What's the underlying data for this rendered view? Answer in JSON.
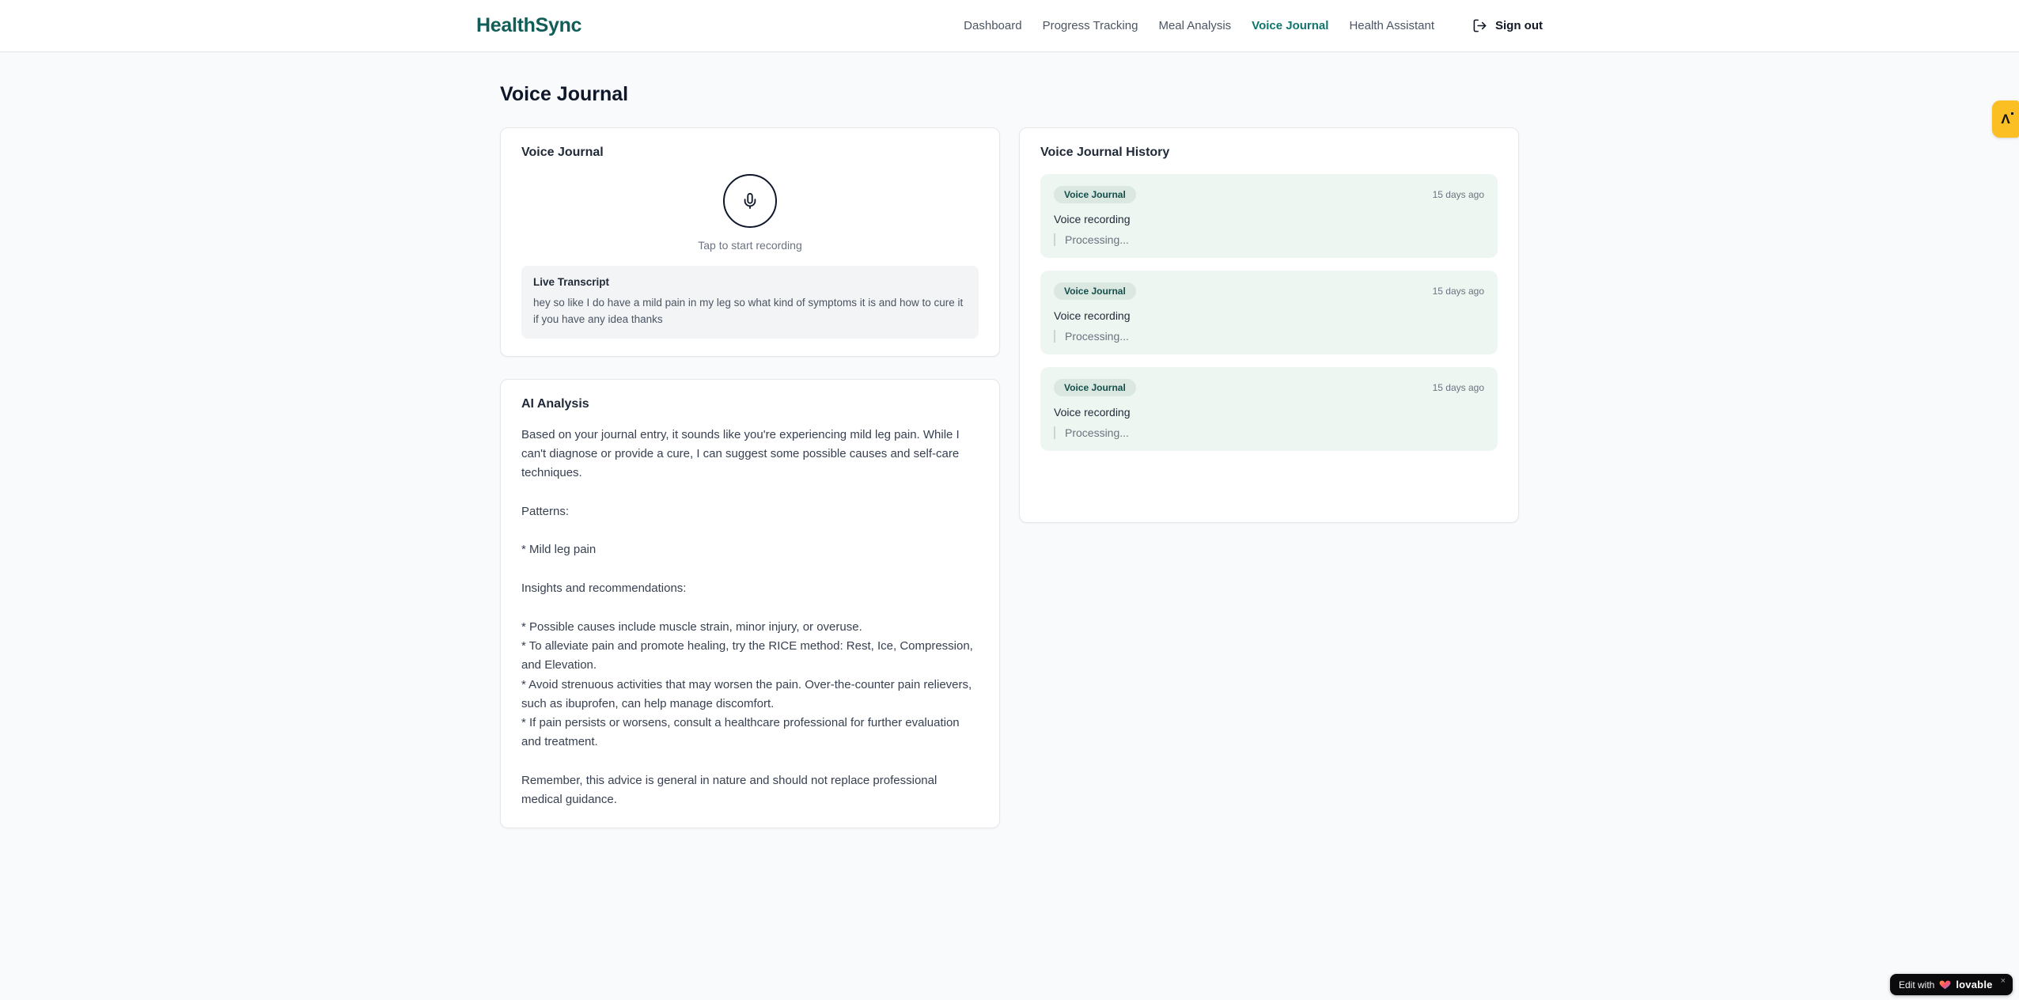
{
  "brand": {
    "name": "HealthSync"
  },
  "nav": {
    "items": [
      {
        "label": "Dashboard"
      },
      {
        "label": "Progress Tracking"
      },
      {
        "label": "Meal Analysis"
      },
      {
        "label": "Voice Journal"
      },
      {
        "label": "Health Assistant"
      }
    ],
    "active_item": "Voice Journal",
    "sign_out_label": "Sign out"
  },
  "page": {
    "title": "Voice Journal"
  },
  "recorder_card": {
    "title": "Voice Journal",
    "tap_hint": "Tap to start recording",
    "transcript_title": "Live Transcript",
    "transcript_text": "hey so like I do have a mild pain in my leg so what kind of symptoms it is and how to cure it if you have any idea thanks"
  },
  "analysis_card": {
    "title": "AI Analysis",
    "body": "Based on your journal entry, it sounds like you're experiencing mild leg pain. While I can't diagnose or provide a cure, I can suggest some possible causes and self-care techniques.\n\nPatterns:\n\n* Mild leg pain\n\nInsights and recommendations:\n\n* Possible causes include muscle strain, minor injury, or overuse.\n* To alleviate pain and promote healing, try the RICE method: Rest, Ice, Compression, and Elevation.\n* Avoid strenuous activities that may worsen the pain. Over-the-counter pain relievers, such as ibuprofen, can help manage discomfort.\n* If pain persists or worsens, consult a healthcare professional for further evaluation and treatment.\n\nRemember, this advice is general in nature and should not replace professional medical guidance."
  },
  "history_card": {
    "title": "Voice Journal History",
    "entries": [
      {
        "badge": "Voice Journal",
        "time": "15 days ago",
        "title": "Voice recording",
        "status": "Processing..."
      },
      {
        "badge": "Voice Journal",
        "time": "15 days ago",
        "title": "Voice recording",
        "status": "Processing..."
      },
      {
        "badge": "Voice Journal",
        "time": "15 days ago",
        "title": "Voice recording",
        "status": "Processing..."
      }
    ]
  },
  "floating": {
    "side_fab_glyph": "Λ",
    "edit_badge": {
      "prefix": "Edit with",
      "brand": "lovable",
      "close": "×"
    }
  },
  "colors": {
    "brand_teal": "#115e59",
    "active_nav_teal": "#0f766e",
    "entry_bg_green": "#eef6f1",
    "badge_bg_green": "#dbe7e1",
    "badge_text_green": "#134e4a",
    "fab_orange": "#fbbf24",
    "page_bg": "#f8fafc"
  }
}
